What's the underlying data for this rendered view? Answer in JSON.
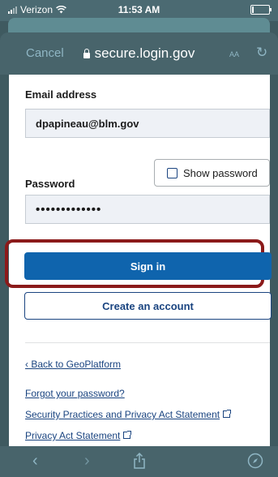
{
  "status_bar": {
    "carrier": "Verizon",
    "time": "11:53 AM",
    "battery_level": 0.12
  },
  "browser": {
    "cancel_label": "Cancel",
    "domain": "secure.login.gov",
    "text_size_label": "AA"
  },
  "form": {
    "email_label": "Email address",
    "email_value": "dpapineau@blm.gov",
    "password_label": "Password",
    "password_value": "•••••••••••••",
    "show_password_label": "Show password",
    "show_password_checked": false,
    "sign_in_label": "Sign in",
    "create_account_label": "Create an account"
  },
  "links": {
    "back": "‹ Back to GeoPlatform",
    "forgot": "Forgot your password?",
    "security": "Security Practices and Privacy Act Statement",
    "privacy": "Privacy Act Statement"
  },
  "toolbar_icons": [
    "back-icon",
    "forward-icon",
    "share-icon",
    "compass-icon"
  ],
  "colors": {
    "primary": "#0f64ad",
    "link": "#1a4480",
    "highlight": "#8b1a1a",
    "browser_chrome": "#48646b"
  }
}
